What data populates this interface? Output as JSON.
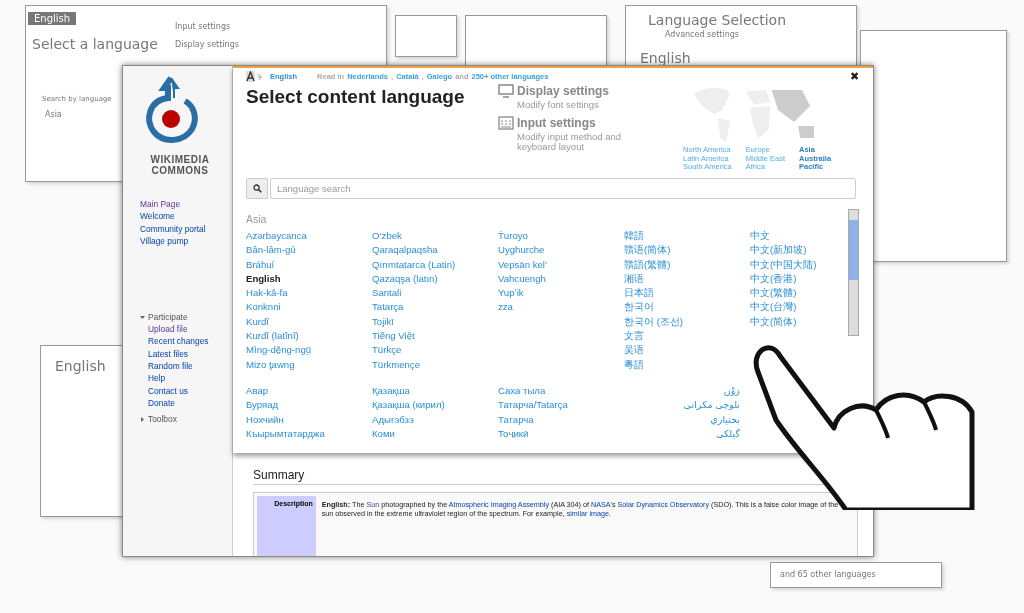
{
  "sketch_notes": [
    {
      "text": "English",
      "kind": "tab"
    },
    {
      "text": "Select a language",
      "kind": "title"
    },
    {
      "text": "Input settings",
      "kind": "note"
    },
    {
      "text": "Display settings",
      "kind": "note"
    },
    {
      "text": "Search by language",
      "kind": "field"
    },
    {
      "text": "Asia",
      "kind": "note"
    },
    {
      "text": "Language Selection",
      "kind": "title"
    },
    {
      "text": "Advanced settings",
      "kind": "note"
    },
    {
      "text": "English",
      "kind": "title"
    },
    {
      "text": "English",
      "kind": "title"
    },
    {
      "text": "and 65 other languages",
      "kind": "note"
    }
  ],
  "sidebar": {
    "logo_text": [
      "WIKIMEDIA",
      "COMMONS"
    ],
    "navigation": [
      {
        "label": "Main Page",
        "visited": true
      },
      {
        "label": "Welcome",
        "visited": false
      },
      {
        "label": "Community portal",
        "visited": false
      },
      {
        "label": "Village pump",
        "visited": false
      }
    ],
    "sections": [
      {
        "label": "Participate",
        "expanded": true,
        "items": [
          {
            "label": "Upload file",
            "visited": true
          },
          {
            "label": "Recent changes",
            "visited": false
          },
          {
            "label": "Latest files",
            "visited": false
          },
          {
            "label": "Random file",
            "visited": false
          },
          {
            "label": "Help",
            "visited": false
          },
          {
            "label": "Contact us",
            "visited": false
          },
          {
            "label": "Donate",
            "visited": false
          }
        ]
      },
      {
        "label": "Toolbox",
        "expanded": false
      }
    ]
  },
  "dialog": {
    "current_language": "English",
    "read_in": [
      {
        "text": "Read in",
        "link": false
      },
      {
        "text": "Nederlands",
        "link": true
      },
      {
        "text": ",",
        "link": false
      },
      {
        "text": "Català",
        "link": true
      },
      {
        "text": ",",
        "link": false
      },
      {
        "text": "Galego",
        "link": true
      },
      {
        "text": "and",
        "link": false
      },
      {
        "text": "250+ other languages",
        "link": true
      }
    ],
    "close": "✖",
    "title": "Select content language",
    "settings": [
      {
        "kind": "display",
        "title": "Display settings",
        "description": "Modify font settings"
      },
      {
        "kind": "input",
        "title": "Input settings",
        "description": "Modify input method and keyboard layout"
      }
    ],
    "regions": [
      [
        {
          "label": "North America",
          "selected": false
        },
        {
          "label": "Latin America",
          "selected": false
        },
        {
          "label": "South America",
          "selected": false
        }
      ],
      [
        {
          "label": "Europe",
          "selected": false
        },
        {
          "label": "Middle East",
          "selected": false
        },
        {
          "label": "Africa",
          "selected": false
        }
      ],
      [
        {
          "label": "Asia",
          "selected": true
        },
        {
          "label": "Australia",
          "selected": true
        },
        {
          "label": "Pacific",
          "selected": true
        }
      ]
    ],
    "search": {
      "placeholder": "Language search"
    },
    "group_heading": "Asia",
    "blocks": [
      {
        "columns": [
          [
            {
              "label": "Azərbaycanca",
              "selected": false
            },
            {
              "label": "Bân-lâm-gú",
              "selected": false
            },
            {
              "label": "Bráhuí",
              "selected": false
            },
            {
              "label": "English",
              "selected": true
            },
            {
              "label": "Hak-kâ-fa",
              "selected": false
            },
            {
              "label": "Konknni",
              "selected": false
            },
            {
              "label": "Kurdî",
              "selected": false
            },
            {
              "label": "Kurdî (latînî)",
              "selected": false
            },
            {
              "label": "Mìng-dĕ̤ng-ngṳ̄",
              "selected": false
            },
            {
              "label": "Mizo ţawng",
              "selected": false
            }
          ],
          [
            {
              "label": "O‘zbek",
              "selected": false
            },
            {
              "label": "Qaraqalpaqsha",
              "selected": false
            },
            {
              "label": "Qırımtatarca (Latin)",
              "selected": false
            },
            {
              "label": "Qazaqşa (latın)",
              "selected": false
            },
            {
              "label": "Santali",
              "selected": false
            },
            {
              "label": "Tatarça",
              "selected": false
            },
            {
              "label": "Tojikī",
              "selected": false
            },
            {
              "label": "Tiếng Việt",
              "selected": false
            },
            {
              "label": "Türkçe",
              "selected": false
            },
            {
              "label": "Türkmençe",
              "selected": false
            }
          ],
          [
            {
              "label": "Ṫuroyo",
              "selected": false
            },
            {
              "label": "Uyghurche",
              "selected": false
            },
            {
              "label": "Vepsän kel’",
              "selected": false
            },
            {
              "label": "Vahcuengh",
              "selected": false
            },
            {
              "label": "Yupʼik",
              "selected": false
            },
            {
              "label": "zza",
              "selected": false
            }
          ],
          [
            {
              "label": "韓語",
              "selected": false
            },
            {
              "label": "贛语(简体)",
              "selected": false
            },
            {
              "label": "贛語(繁體)",
              "selected": false
            },
            {
              "label": "湘语",
              "selected": false
            },
            {
              "label": "日本語",
              "selected": false
            },
            {
              "label": "한국어",
              "selected": false
            },
            {
              "label": "한국어 (조선)",
              "selected": false
            },
            {
              "label": "文言",
              "selected": false
            },
            {
              "label": "吴语",
              "selected": false
            },
            {
              "label": "粵語",
              "selected": false
            }
          ],
          [
            {
              "label": "中文",
              "selected": false
            },
            {
              "label": "中文(新加坡)",
              "selected": false
            },
            {
              "label": "中文(中国大陆)",
              "selected": false
            },
            {
              "label": "中文(香港)",
              "selected": false
            },
            {
              "label": "中文(繁體)",
              "selected": false
            },
            {
              "label": "中文(台灣)",
              "selected": false
            },
            {
              "label": "中文(简体)",
              "selected": false
            }
          ]
        ]
      },
      {
        "columns": [
          [
            {
              "label": "Авар",
              "selected": false
            },
            {
              "label": "Буряад",
              "selected": false
            },
            {
              "label": "Нохчийн",
              "selected": false
            },
            {
              "label": "Къырымтатарджа",
              "selected": false
            }
          ],
          [
            {
              "label": "Қазақша",
              "selected": false
            },
            {
              "label": "Қазақша (кирил)",
              "selected": false
            },
            {
              "label": "Адыгэбзэ",
              "selected": false
            },
            {
              "label": "Коми",
              "selected": false
            }
          ],
          [
            {
              "label": "Саха тыла",
              "selected": false
            },
            {
              "label": "Татарча/Tatarça",
              "selected": false
            },
            {
              "label": "Татарча",
              "selected": false
            },
            {
              "label": "Тоҷикӣ",
              "selected": false
            }
          ],
          [
            {
              "label": "زوْن",
              "selected": false
            },
            {
              "label": "بلوچی مکرانی",
              "selected": false
            },
            {
              "label": "بختياري",
              "selected": false
            },
            {
              "label": "گیلکی",
              "selected": false
            }
          ]
        ]
      }
    ]
  },
  "summary": {
    "heading": "Summary",
    "label": "Description",
    "text": [
      {
        "kind": "bold",
        "text": "English:"
      },
      {
        "kind": "text",
        "text": "The"
      },
      {
        "kind": "visited",
        "text": "Sun"
      },
      {
        "kind": "text",
        "text": "photographed by the"
      },
      {
        "kind": "link",
        "text": "Atmospheric Imaging Assembly"
      },
      {
        "kind": "text",
        "text": "(AIA 304) of"
      },
      {
        "kind": "link",
        "text": "NASA"
      },
      {
        "kind": "text",
        "text": "'s"
      },
      {
        "kind": "link",
        "text": "Solar Dynamics Observatory"
      },
      {
        "kind": "text",
        "text": "(SDO). This is a false color image of the sun observed in the extreme ultraviolet region of the spectrum. For example,"
      },
      {
        "kind": "link",
        "text": "similar image"
      },
      {
        "kind": "text",
        "text": "."
      }
    ]
  }
}
